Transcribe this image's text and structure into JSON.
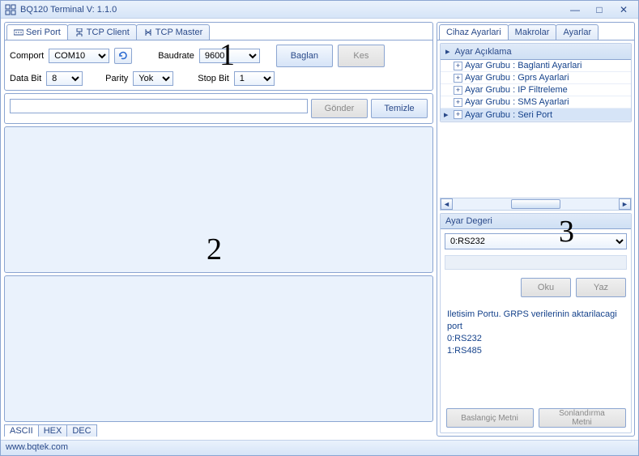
{
  "window": {
    "title": "BQ120 Terminal     V: 1.1.0",
    "min": "—",
    "restore": "□",
    "close": "✕"
  },
  "conn_tabs": [
    "Seri Port",
    "TCP Client",
    "TCP Master"
  ],
  "connection": {
    "comport_label": "Comport",
    "comport_value": "COM10",
    "baudrate_label": "Baudrate",
    "baudrate_value": "9600",
    "databit_label": "Data Bit",
    "databit_value": "8",
    "parity_label": "Parity",
    "parity_value": "Yok",
    "stopbit_label": "Stop Bit",
    "stopbit_value": "1",
    "connect_btn": "Baglan",
    "disconnect_btn": "Kes"
  },
  "send": {
    "send_btn": "Gönder",
    "clear_btn": "Temizle",
    "input_value": ""
  },
  "fmt_tabs": [
    "ASCII",
    "HEX",
    "DEC"
  ],
  "right_tabs": [
    "Cihaz Ayarlari",
    "Makrolar",
    "Ayarlar"
  ],
  "tree_header": "Ayar Açıklama",
  "tree_items": [
    "Ayar Grubu : Baglanti Ayarlari",
    "Ayar Grubu : Gprs Ayarlari",
    "Ayar Grubu : IP Filtreleme",
    "Ayar Grubu : SMS Ayarlari",
    "Ayar Grubu : Seri Port"
  ],
  "value_header": "Ayar Degeri",
  "value_selected": "0:RS232",
  "read_btn": "Oku",
  "write_btn": "Yaz",
  "description": {
    "line1": "Iletisim Portu. GRPS verilerinin aktarilacagi port",
    "line2": "0:RS232",
    "line3": "1:RS485"
  },
  "start_text_btn": "Baslangiç Metni",
  "end_text_btn": "Sonlandırma Metni",
  "status_url": "www.bqtek.com",
  "big_numbers": {
    "one": "1",
    "two": "2",
    "three": "3"
  }
}
